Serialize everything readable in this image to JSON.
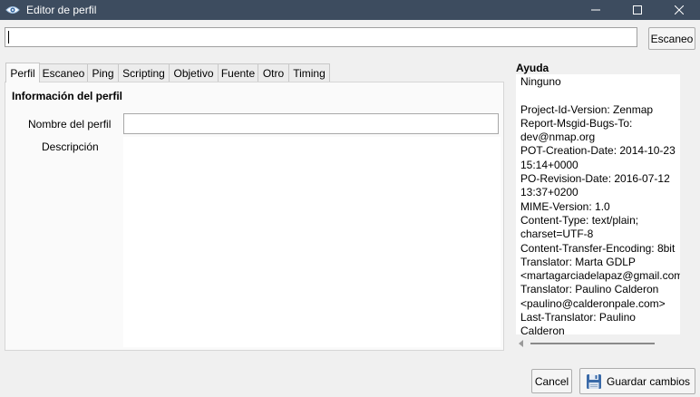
{
  "window": {
    "title": "Editor de perfil",
    "app_icon": "nmap-eye-icon"
  },
  "target": {
    "value": "",
    "scan_label": "Escaneo"
  },
  "tabs": [
    {
      "label": "Perfil",
      "active": true
    },
    {
      "label": "Escaneo"
    },
    {
      "label": "Ping"
    },
    {
      "label": "Scripting"
    },
    {
      "label": "Objetivo"
    },
    {
      "label": "Fuente"
    },
    {
      "label": "Otro"
    },
    {
      "label": "Timing"
    }
  ],
  "profile": {
    "section_title": "Información del perfil",
    "name_label": "Nombre del perfil",
    "name_value": "",
    "desc_label": "Descripción",
    "desc_value": ""
  },
  "help": {
    "title": "Ayuda",
    "text": "Ninguno\n\nProject-Id-Version: Zenmap\nReport-Msgid-Bugs-To:\ndev@nmap.org\nPOT-Creation-Date: 2014-10-23\n15:14+0000\nPO-Revision-Date: 2016-07-12\n13:37+0200\nMIME-Version: 1.0\nContent-Type: text/plain;\ncharset=UTF-8\nContent-Transfer-Encoding: 8bit\nTranslator: Marta GDLP\n<martagarciadelapaz@gmail.com>\nTranslator: Paulino Calderon\n<paulino@calderonpale.com>\nLast-Translator: Paulino\nCalderon"
  },
  "footer": {
    "cancel_label": "Cancel",
    "save_label": "Guardar cambios",
    "save_icon": "floppy-disk-icon"
  }
}
